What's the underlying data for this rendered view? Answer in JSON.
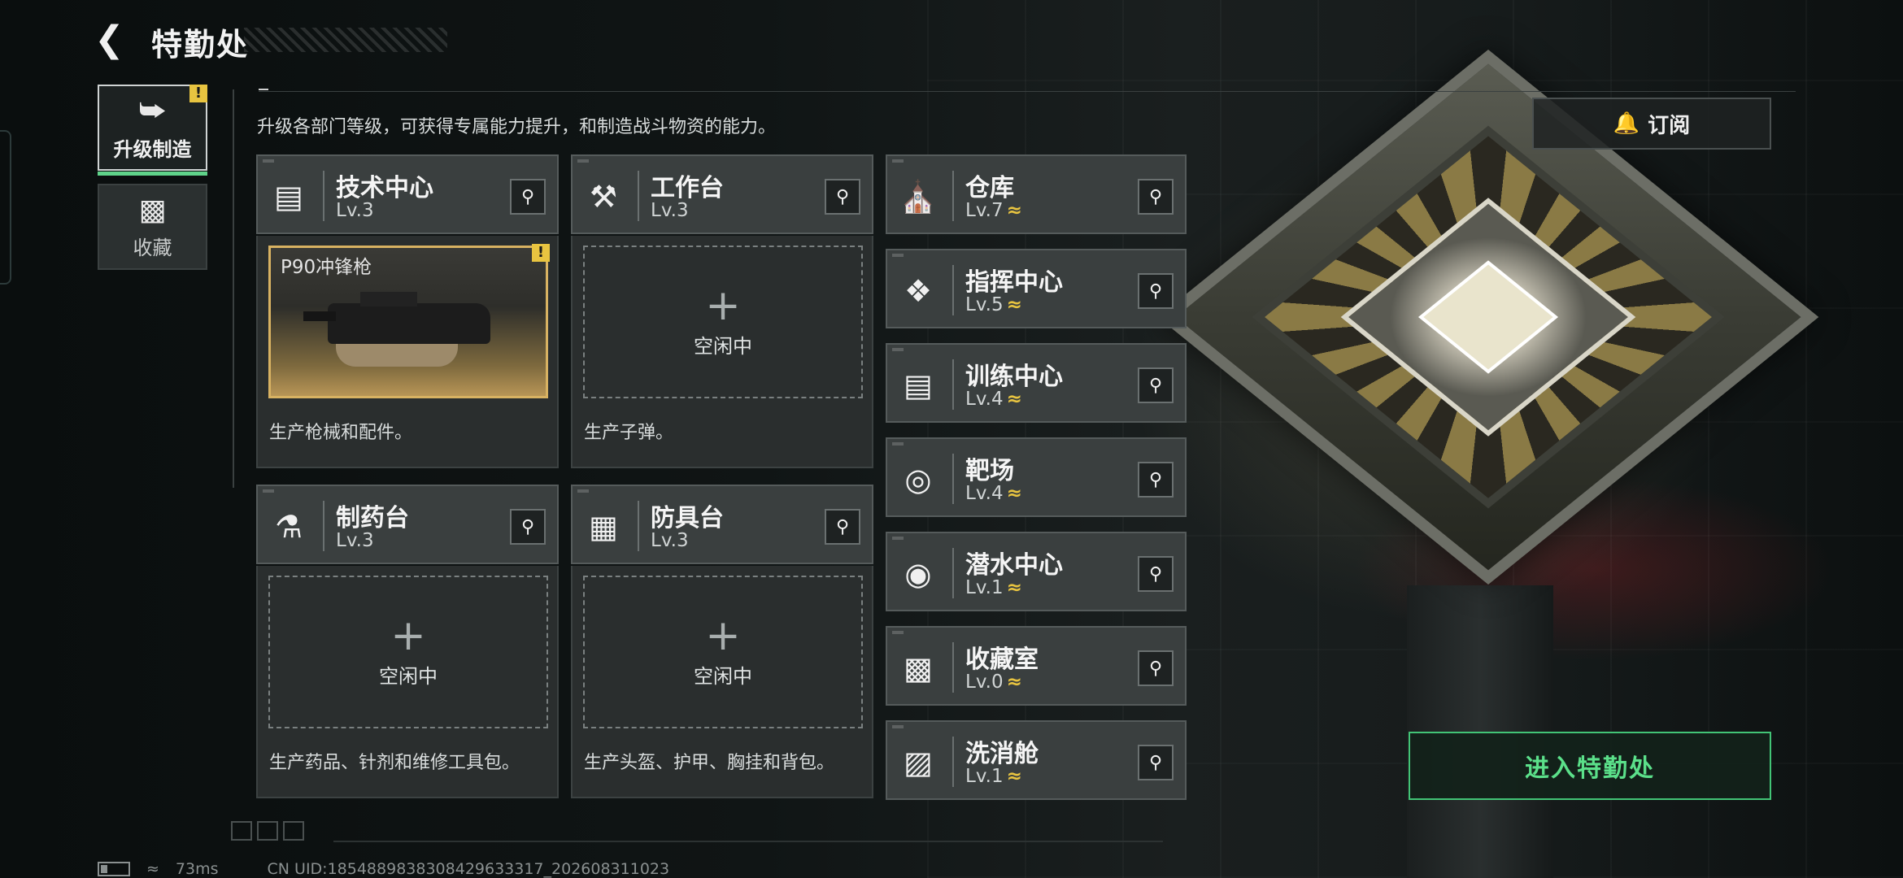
{
  "header": {
    "title": "特勤处"
  },
  "tabs": [
    {
      "label": "升级制造",
      "icon": "upgrade-icon",
      "active": true,
      "badge": "!"
    },
    {
      "label": "收藏",
      "icon": "collection-icon",
      "active": false
    }
  ],
  "description": "升级各部门等级，可获得专属能力提升，和制造战斗物资的能力。",
  "subscribe_label": "订阅",
  "enter_label": "进入特勤处",
  "production": {
    "tech": {
      "name": "技术中心",
      "level": "Lv.3",
      "item_name": "P90冲锋枪",
      "badge": "!",
      "desc": "生产枪械和配件。"
    },
    "workbench": {
      "name": "工作台",
      "level": "Lv.3",
      "idle": "空闲中",
      "desc": "生产子弹。"
    },
    "pharmacy": {
      "name": "制药台",
      "level": "Lv.3",
      "idle": "空闲中",
      "desc": "生产药品、针剂和维修工具包。"
    },
    "armor": {
      "name": "防具台",
      "level": "Lv.3",
      "idle": "空闲中",
      "desc": "生产头盔、护甲、胸挂和背包。"
    }
  },
  "departments": [
    {
      "name": "仓库",
      "level": "Lv.7",
      "icon": "warehouse-icon",
      "upgradable": true
    },
    {
      "name": "指挥中心",
      "level": "Lv.5",
      "icon": "command-icon",
      "upgradable": true
    },
    {
      "name": "训练中心",
      "level": "Lv.4",
      "icon": "dumbbell-icon",
      "upgradable": true
    },
    {
      "name": "靶场",
      "level": "Lv.4",
      "icon": "target-icon",
      "upgradable": true
    },
    {
      "name": "潜水中心",
      "level": "Lv.1",
      "icon": "diving-mask-icon",
      "upgradable": true
    },
    {
      "name": "收藏室",
      "level": "Lv.0",
      "icon": "collection-room-icon",
      "upgradable": true
    },
    {
      "name": "洗消舱",
      "level": "Lv.1",
      "icon": "decontamination-icon",
      "upgradable": true
    }
  ],
  "upgrade_glyph": "≈",
  "status": {
    "ping": "73ms",
    "uid": "CN UID:1854889838308429633317_202608311023"
  },
  "colors": {
    "accent_green": "#42c476",
    "warning_yellow": "#e8c440",
    "item_gold": "#d8b262"
  }
}
